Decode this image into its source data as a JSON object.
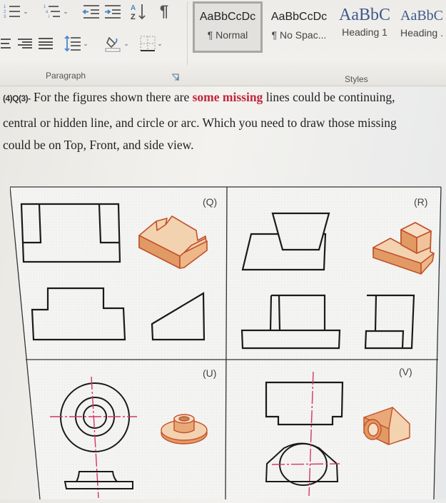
{
  "ribbon": {
    "paragraph_group": {
      "label": "Paragraph",
      "buttons": [
        {
          "name": "numbering",
          "icon": "numbered-list-icon"
        },
        {
          "name": "multilevel-list",
          "icon": "multilevel-list-icon"
        },
        {
          "name": "decrease-indent",
          "icon": "decrease-indent-icon"
        },
        {
          "name": "increase-indent",
          "icon": "increase-indent-icon"
        },
        {
          "name": "sort",
          "icon": "sort-az-icon"
        },
        {
          "name": "show-hide",
          "icon": "pilcrow-icon",
          "glyph": "¶"
        },
        {
          "name": "align-center",
          "icon": "align-center-icon"
        },
        {
          "name": "align-right",
          "icon": "align-right-icon"
        },
        {
          "name": "justify",
          "icon": "justify-icon"
        },
        {
          "name": "line-spacing",
          "icon": "line-spacing-icon"
        },
        {
          "name": "shading",
          "icon": "paint-bucket-icon"
        },
        {
          "name": "borders",
          "icon": "borders-icon"
        }
      ]
    },
    "styles_group": {
      "label": "Styles",
      "items": [
        {
          "sample": "AaBbCcDc",
          "name": "¶ Normal",
          "selected": true
        },
        {
          "sample": "AaBbCcDc",
          "name": "¶ No Spac..."
        },
        {
          "sample": "AaBbC",
          "name": "Heading 1"
        },
        {
          "sample": "AaBbC",
          "name": "Heading ."
        }
      ]
    }
  },
  "document": {
    "question_prefix": "(4)Q(3)-",
    "line1_a": " For the figures shown there are ",
    "line1_highlight": "some missing",
    "line1_b": " lines could be continuing,",
    "line2": "central or hidden line, and circle or arc. Which you need to draw those missing",
    "line3": "could be on Top, Front, and side view."
  },
  "figure": {
    "panels": [
      {
        "label": "(Q)"
      },
      {
        "label": "(R)"
      },
      {
        "label": "(U)"
      },
      {
        "label": "(V)"
      }
    ],
    "colors": {
      "line": "#1a1a1a",
      "centerline": "#d4336a",
      "part_light": "#f3d2b0",
      "part_mid": "#e9a877",
      "part_dark": "#d98648",
      "part_edge": "#c2502a"
    }
  }
}
